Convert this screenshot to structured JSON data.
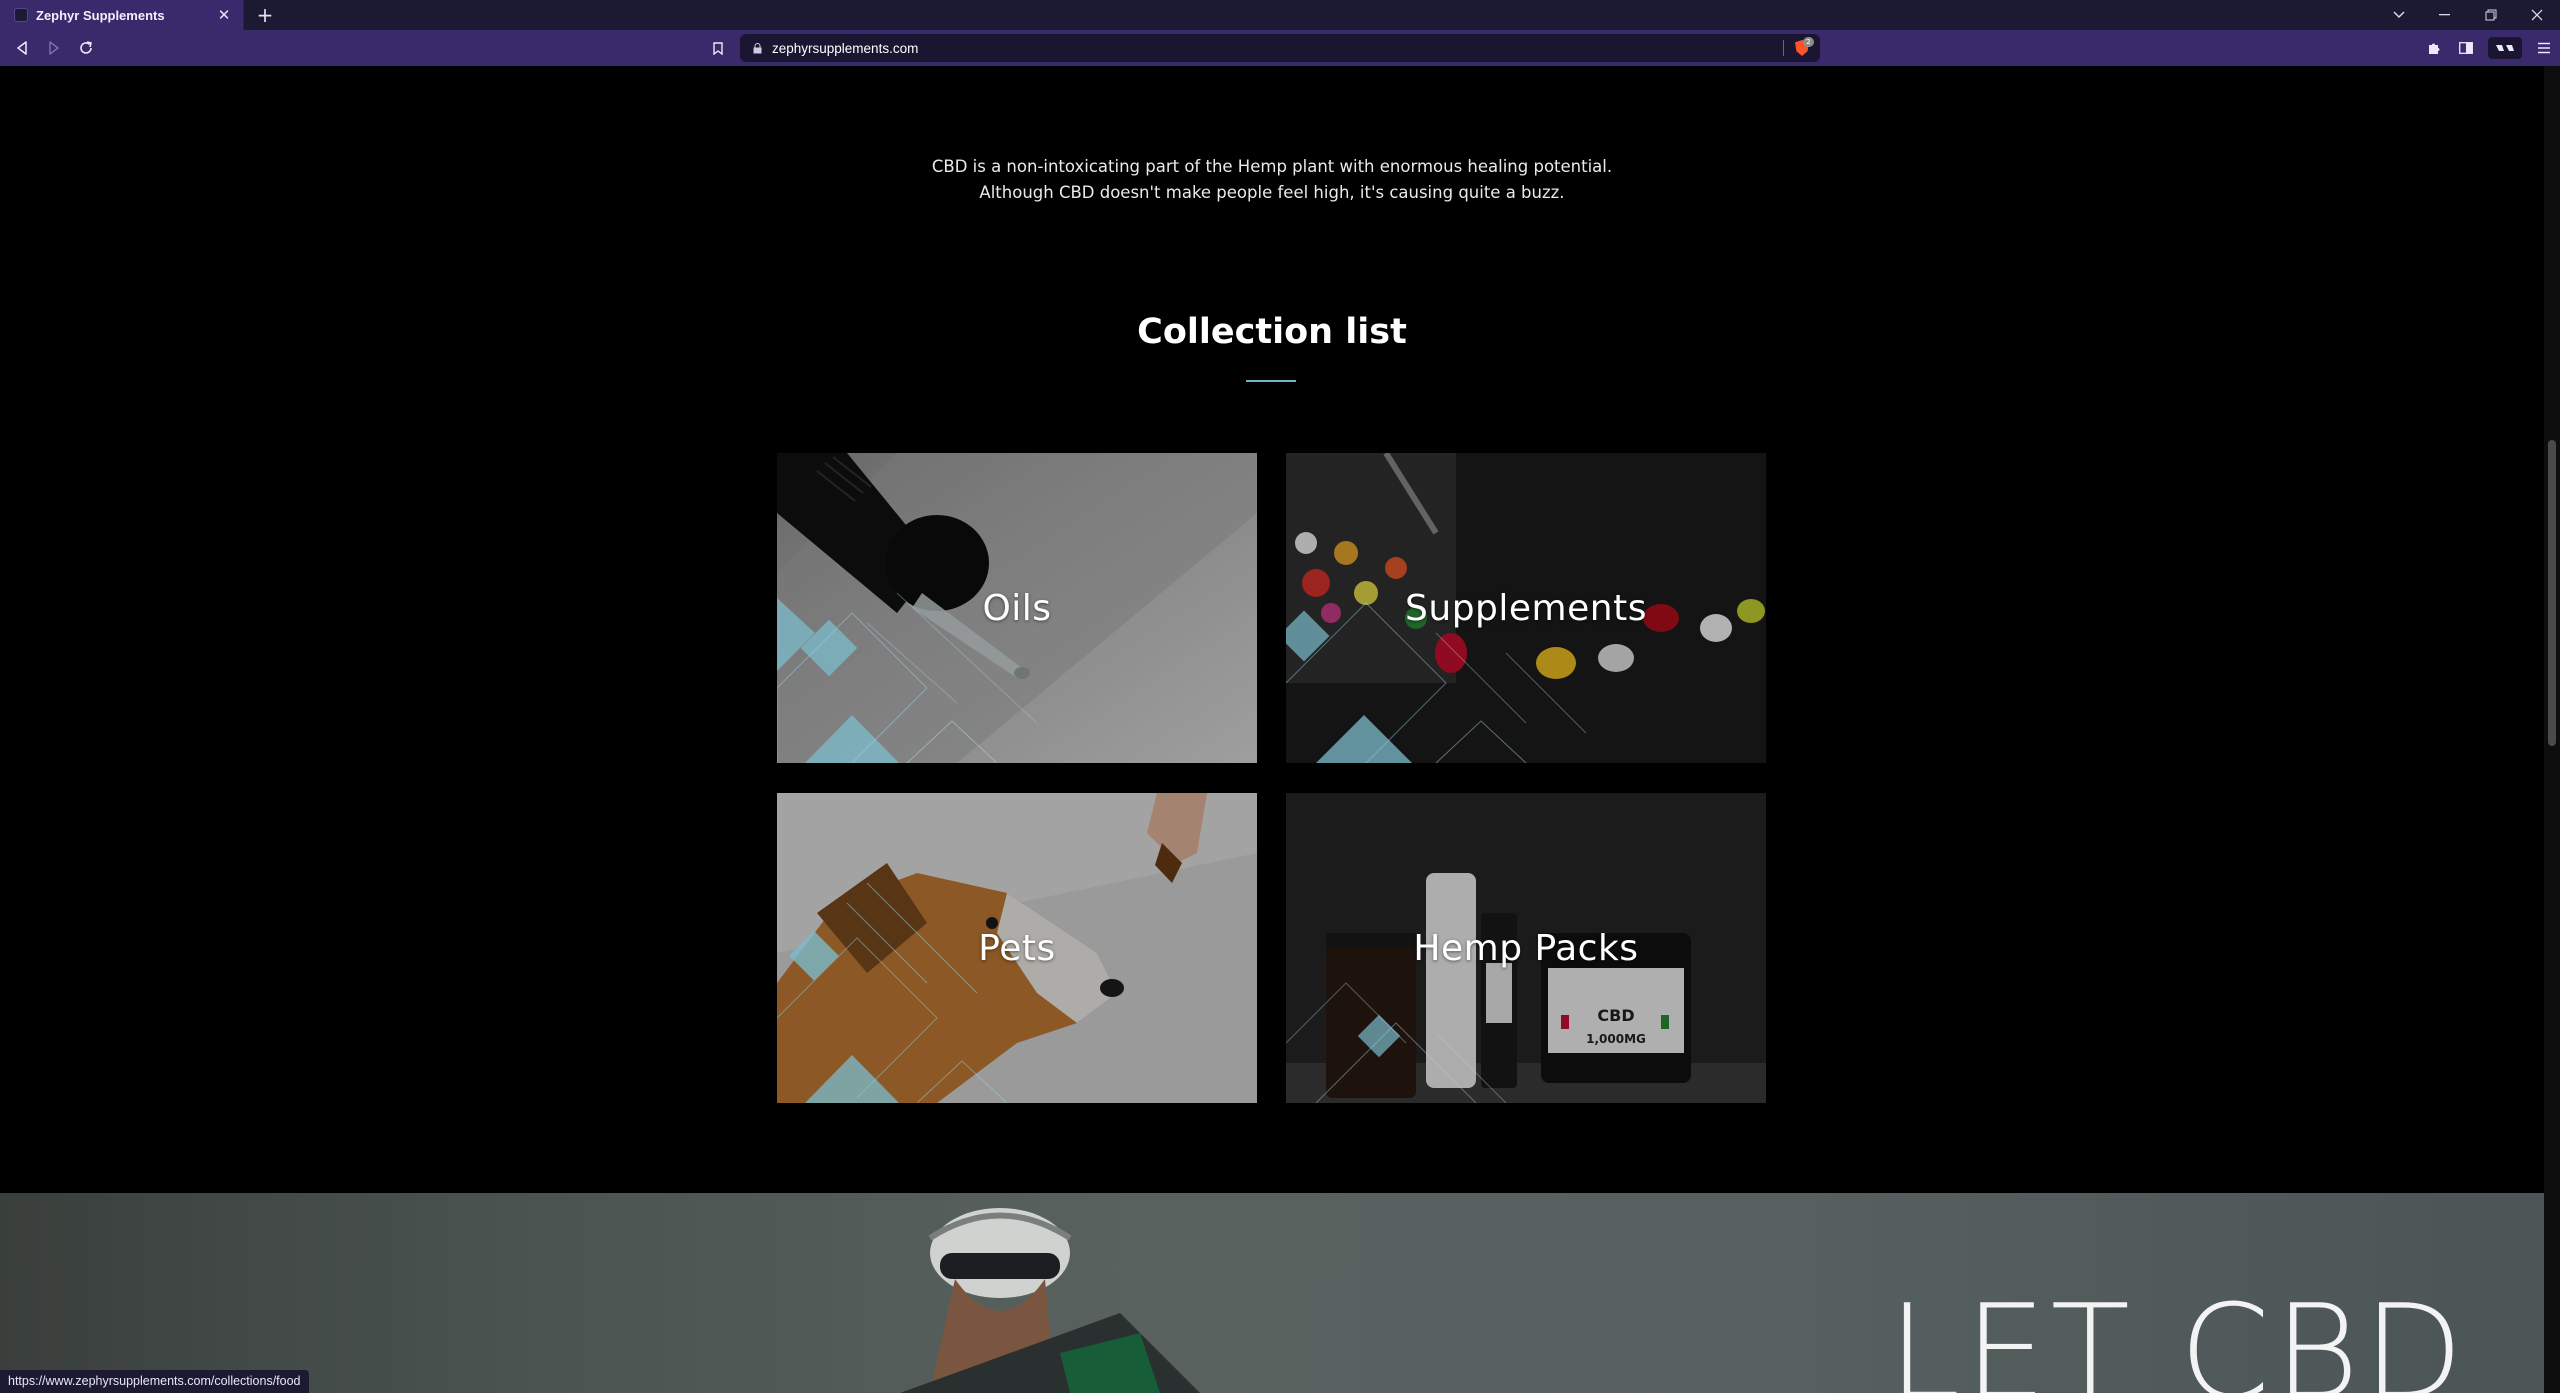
{
  "browser": {
    "tab_title": "Zephyr Supplements",
    "tab_close_glyph": "✕",
    "new_tab_glyph": "+",
    "url": "zephyrsupplements.com",
    "shield_badge": "2",
    "status_url": "https://www.zephyrsupplements.com/collections/food"
  },
  "page": {
    "intro_line1": "CBD is a non-intoxicating part of the Hemp plant with enormous healing potential.",
    "intro_line2": "Although CBD doesn't make people feel high, it's causing quite a buzz.",
    "section_title": "Collection list",
    "collections": [
      {
        "label": "Oils"
      },
      {
        "label": "Supplements"
      },
      {
        "label": "Pets"
      },
      {
        "label": "Hemp Packs"
      }
    ],
    "hero_text": "LET CBD"
  },
  "colors": {
    "chrome_dark": "#1c1933",
    "chrome_purple": "#3a2a6b",
    "accent_teal": "#6fb6c6",
    "page_bg": "#000000"
  },
  "icons": {
    "back": "arrow-left-icon",
    "forward": "arrow-right-icon",
    "reload": "reload-icon",
    "bookmark": "bookmark-icon",
    "lock": "lock-icon",
    "shield": "brave-shield-icon",
    "extensions": "puzzle-icon",
    "sidebar": "sidebar-icon",
    "wallet": "wallet-icon",
    "menu": "hamburger-menu-icon"
  }
}
